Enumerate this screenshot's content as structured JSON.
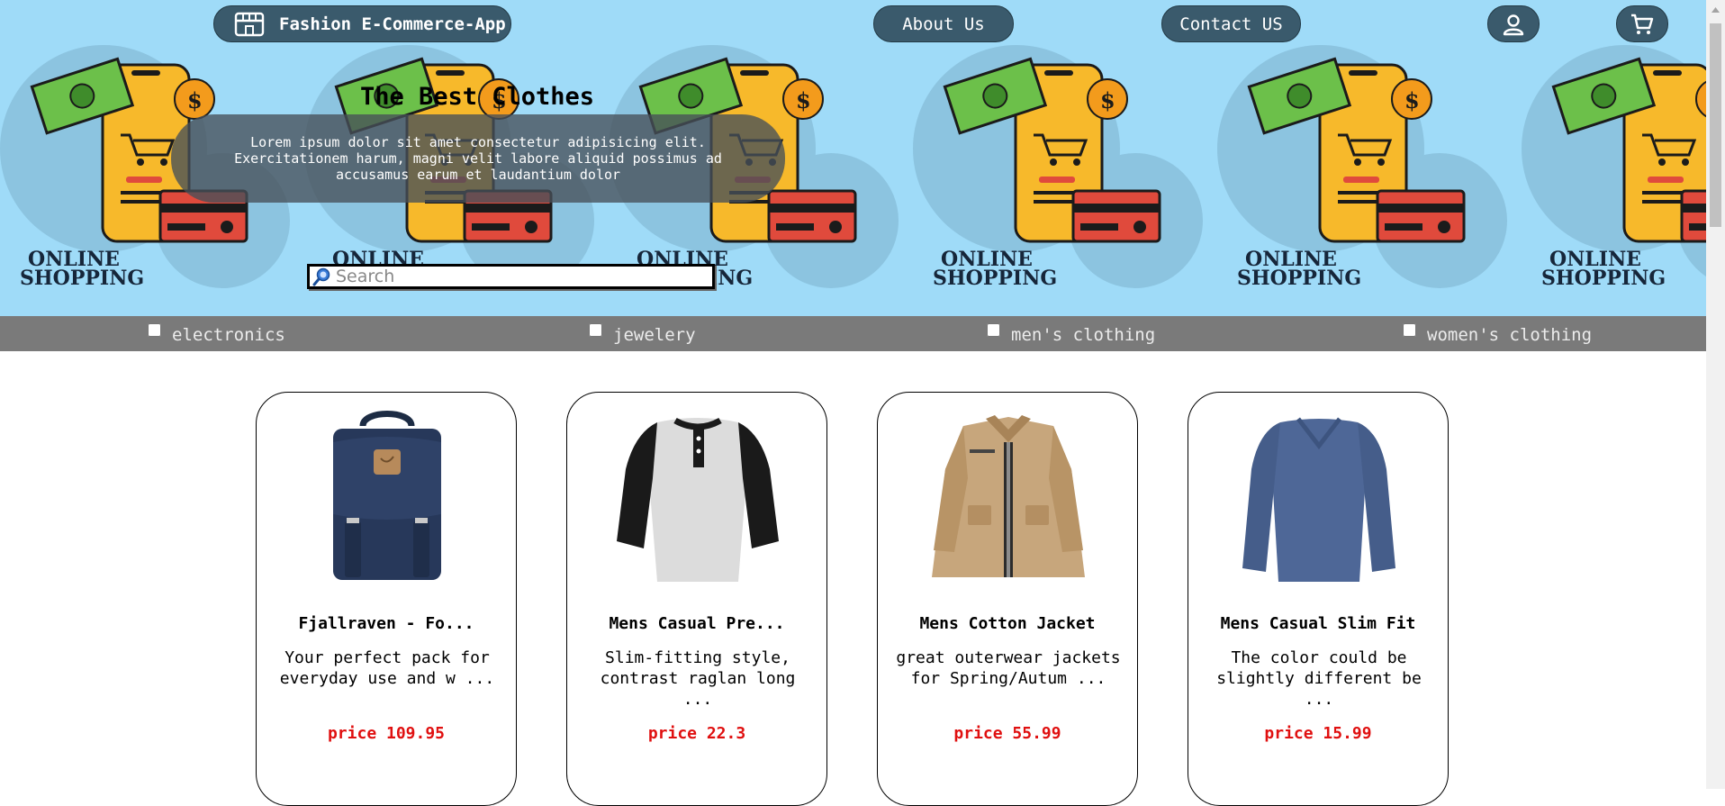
{
  "nav": {
    "brand_label": "Fashion E-Commerce-App",
    "brand_icon": "store-icon",
    "about_label": "About Us",
    "contact_label": "Contact US",
    "user_icon": "user-icon",
    "cart_icon": "cart-icon",
    "pill_color": "#3a5a6c"
  },
  "hero": {
    "background_color": "#9fdbf8",
    "banner_caption_line1": "ONLINE",
    "banner_caption_line2": "SHOPPING",
    "title": "The Best Clothes",
    "subtitle": "Lorem ipsum dolor sit amet consectetur adipisicing elit. Exercitationem harum, magni velit labore aliquid possimus ad accusamus earum et laudantium dolor",
    "search_placeholder": "Search",
    "search_value": ""
  },
  "filters": [
    {
      "label": "electronics",
      "checked": false
    },
    {
      "label": "jewelery",
      "checked": false
    },
    {
      "label": "men's clothing",
      "checked": false
    },
    {
      "label": "women's clothing",
      "checked": false
    }
  ],
  "products": [
    {
      "name": "Fjallraven - Fo...",
      "description": "Your perfect pack for everyday use and w ...",
      "price": "price 109.95",
      "image": "backpack-image"
    },
    {
      "name": "Mens Casual Pre...",
      "description": "Slim-fitting style, contrast raglan long ...",
      "price": "price 22.3",
      "image": "raglan-shirt-image"
    },
    {
      "name": "Mens Cotton Jacket",
      "description": "great outerwear jackets for Spring/Autum ...",
      "price": "price 55.99",
      "image": "cotton-jacket-image"
    },
    {
      "name": "Mens Casual Slim Fit",
      "description": "The color could be slightly different be ...",
      "price": "price 15.99",
      "image": "slim-fit-shirt-image"
    }
  ],
  "colors": {
    "filter_bar": "#7a7a7a",
    "price": "#e01010"
  }
}
